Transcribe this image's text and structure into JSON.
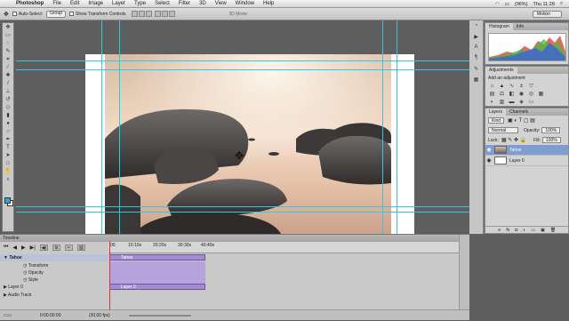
{
  "menubar": {
    "app": "Photoshop",
    "items": [
      "File",
      "Edit",
      "Image",
      "Layer",
      "Type",
      "Select",
      "Filter",
      "3D",
      "View",
      "Window",
      "Help"
    ],
    "battery": "(96%)",
    "time": "Thu 11:28"
  },
  "options": {
    "auto_select_label": "Auto-Select:",
    "auto_select_value": "Group",
    "show_transform": "Show Transform Controls",
    "mode_3d": "3D Mode:",
    "workspace": "Motion"
  },
  "panels": {
    "histogram_tab": "Histogram",
    "info_tab": "Info",
    "adjustments_tab": "Adjustments",
    "add_adjustment": "Add an adjustment",
    "layers_tab": "Layers",
    "channels_tab": "Channels",
    "kind": "Kind",
    "blend_mode": "Normal",
    "opacity_label": "Opacity:",
    "opacity_value": "100%",
    "lock_label": "Lock:",
    "fill_label": "Fill:",
    "fill_value": "100%",
    "layers": [
      {
        "name": "Tahoe",
        "selected": true
      },
      {
        "name": "Layer 0",
        "selected": false
      }
    ]
  },
  "timeline": {
    "title": "Timeline",
    "ticks": [
      "00",
      "10:10s",
      "20:20s",
      "30:30s",
      "40:40s"
    ],
    "rows": [
      {
        "label": "Tahoe",
        "level": 0
      },
      {
        "label": "Transform",
        "level": 1
      },
      {
        "label": "Opacity",
        "level": 1
      },
      {
        "label": "Style",
        "level": 1
      },
      {
        "label": "Layer 0",
        "level": 0
      },
      {
        "label": "Audio Track",
        "level": 0
      }
    ],
    "clip_tahoe": "Tahoe",
    "clip_layer0": "Layer 0",
    "timecode": "0:00:00:00",
    "fps": "(30.00 fps)"
  },
  "colors": {
    "guide": "#36c6de",
    "clip_purple": "#a58ad4",
    "selection_blue": "#7e9dd0",
    "foreground": "#3aa3d6"
  }
}
